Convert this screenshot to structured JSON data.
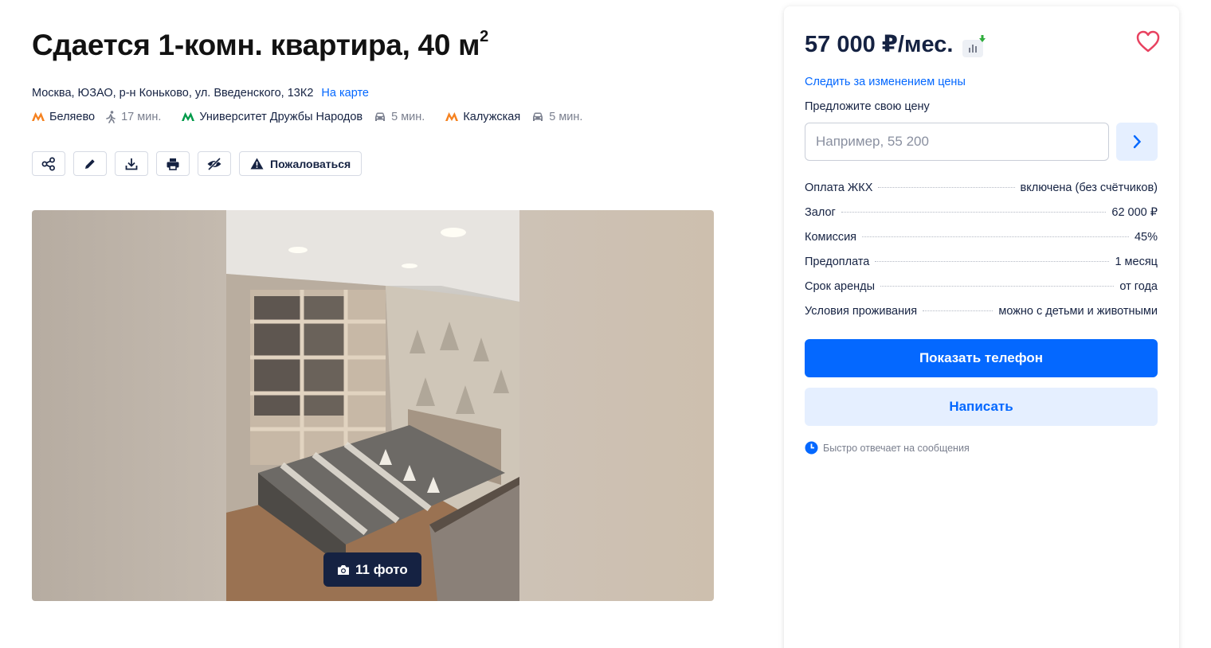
{
  "listing": {
    "title": "Сдается 1-комн. квартира, 40 м",
    "title_sup": "2",
    "address": "Москва, ЮЗАО, р-н Коньково, ул. Введенского, 13К2",
    "map_link": "На карте",
    "metro": [
      {
        "icon": "metro-logo-icon",
        "color": "#f58220",
        "name": "Беляево",
        "mode": "walk-icon",
        "time": "17 мин."
      },
      {
        "icon": "metro-logo-icon",
        "color": "#009a49",
        "name": "Университет Дружбы Народов",
        "mode": "car-icon",
        "time": "5 мин."
      },
      {
        "icon": "metro-logo-icon",
        "color": "#f58220",
        "name": "Калужская",
        "mode": "car-icon",
        "time": "5 мин."
      }
    ],
    "actions": {
      "complain_label": "Пожаловаться"
    },
    "gallery": {
      "photo_count_label": "11 фото"
    }
  },
  "sidebar": {
    "price": "57 000 ₽/мес.",
    "track_price": "Следить за изменением цены",
    "offer_label": "Предложите свою цену",
    "offer_placeholder": "Например, 55 200",
    "terms": [
      {
        "key": "Оплата ЖКХ",
        "value": "включена (без счётчиков)"
      },
      {
        "key": "Залог",
        "value": "62 000 ₽"
      },
      {
        "key": "Комиссия",
        "value": "45%"
      },
      {
        "key": "Предоплата",
        "value": "1 месяц"
      },
      {
        "key": "Срок аренды",
        "value": "от года"
      },
      {
        "key": "Условия проживания",
        "value": "можно с детьми и животными"
      }
    ],
    "show_phone": "Показать телефон",
    "write": "Написать",
    "fast_reply": "Быстро отвечает на сообщения"
  },
  "colors": {
    "accent": "#0468ff",
    "accent_light": "#e5efff",
    "text": "#152242",
    "metro_orange": "#f58220",
    "metro_green": "#009a49"
  }
}
